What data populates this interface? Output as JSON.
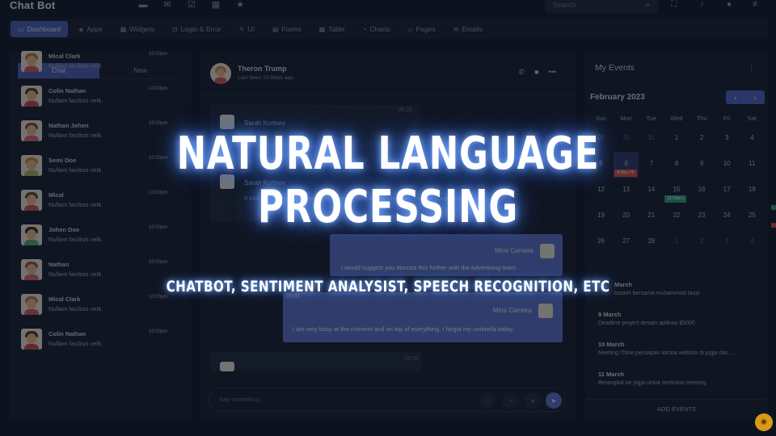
{
  "brand": "Chat Bot",
  "search": {
    "placeholder": "Search"
  },
  "nav": [
    {
      "label": "Dashboard",
      "icon": "monitor-icon",
      "glyph": "▭",
      "active": true
    },
    {
      "label": "Apps",
      "icon": "layers-icon",
      "glyph": "◈"
    },
    {
      "label": "Widgets",
      "icon": "widget-icon",
      "glyph": "▦"
    },
    {
      "label": "Login & Error",
      "icon": "lock-icon",
      "glyph": "⊡"
    },
    {
      "label": "UI",
      "icon": "edit-icon",
      "glyph": "✎"
    },
    {
      "label": "Forms",
      "icon": "file-icon",
      "glyph": "▤"
    },
    {
      "label": "Table",
      "icon": "table-icon",
      "glyph": "▦"
    },
    {
      "label": "Charts",
      "icon": "pie-chart-icon",
      "glyph": "◔"
    },
    {
      "label": "Pages",
      "icon": "folder-icon",
      "glyph": "▱"
    },
    {
      "label": "Emails",
      "icon": "mail-icon",
      "glyph": "✉"
    }
  ],
  "tabs": {
    "chat": "Chat",
    "new": "New"
  },
  "contacts": [
    {
      "name": "Mical Clark",
      "msg": "Nullam facilisis velit.",
      "time": "10:00pm",
      "hair": "#b97a3a",
      "shirt": "#d15b5b"
    },
    {
      "name": "Colin Nathan",
      "msg": "Nullam facilisis velit.",
      "time": "10:00pm",
      "hair": "#5b3a1e",
      "shirt": "#c74c4c"
    },
    {
      "name": "Nathan Johen",
      "msg": "Nullam facilisis velit.",
      "time": "10:00pm",
      "hair": "#8a4e2a",
      "shirt": "#d46a6a"
    },
    {
      "name": "Semi Doe",
      "msg": "Nullam facilisis velit.",
      "time": "10:00pm",
      "hair": "#c7913f",
      "shirt": "#a4b95f"
    },
    {
      "name": "Mical",
      "msg": "Nullam facilisis velit.",
      "time": "10:00pm",
      "hair": "#6e4124",
      "shirt": "#c95656"
    },
    {
      "name": "Johen Doe",
      "msg": "Nullam facilisis velit.",
      "time": "10:00pm",
      "hair": "#3b2818",
      "shirt": "#5da37a"
    },
    {
      "name": "Nathan",
      "msg": "Nullam facilisis velit.",
      "time": "10:00pm",
      "hair": "#9c5a34",
      "shirt": "#d46a6a"
    },
    {
      "name": "Mical Clark",
      "msg": "Nullam facilisis velit.",
      "time": "10:00pm",
      "hair": "#b97a3a",
      "shirt": "#d15b5b"
    },
    {
      "name": "Colin Nathan",
      "msg": "Nullam facilisis velit.",
      "time": "10:00pm",
      "hair": "#5b3a1e",
      "shirt": "#c74c4c"
    }
  ],
  "chat": {
    "name": "Theron Trump",
    "seen": "Last Seen 10:30pm ago",
    "messages": [
      {
        "who": "Sarah Kortney",
        "text": "It looks to me like you have a lot planned before your deadline, I would suggest you p",
        "time": "09:25",
        "side": "in"
      },
      {
        "who": "Sarah Kortney",
        "text": "It looks to me like you have a lot planned before your deadline. I would suggest you p",
        "time": "",
        "side": "in"
      },
      {
        "who": "Mimi Carreira",
        "text": "I would suggest you discuss this further with the advertising team.",
        "time": "",
        "side": "out"
      },
      {
        "who": "Mimi Carreira",
        "text": "I am very busy at the moment and on top of everything, I forgot my umbrella today.",
        "time": "09:41",
        "side": "out"
      },
      {
        "who": "",
        "text": "",
        "time": "09:25",
        "side": "in"
      }
    ],
    "placeholder": "Say something..."
  },
  "events": {
    "title": "My Events",
    "month": "February 2023",
    "weekdays": [
      "Sun",
      "Mon",
      "Tue",
      "Wed",
      "Thu",
      "Fri",
      "Sat"
    ],
    "weeks": [
      [
        "29",
        "30",
        "31",
        "1",
        "2",
        "3",
        "4"
      ],
      [
        "5",
        "6",
        "7",
        "8",
        "9",
        "10",
        "11"
      ],
      [
        "12",
        "13",
        "14",
        "15",
        "16",
        "17",
        "18"
      ],
      [
        "19",
        "20",
        "21",
        "22",
        "23",
        "24",
        "25"
      ],
      [
        "26",
        "27",
        "28",
        "1",
        "2",
        "3",
        "4"
      ]
    ],
    "chips": [
      {
        "text": "9:59a Th",
        "color": "#d9534f"
      },
      {
        "text": "11:59a L",
        "color": "#2aa37a"
      }
    ],
    "list": [
      {
        "date": "March",
        "desc": "basket bersama muhammad fauzi"
      },
      {
        "date": "9 March",
        "desc": "Deadline project desain aplikasi $5000"
      },
      {
        "date": "10 March",
        "desc": "Meeting ITone persiapan lomba website di jogja dan ..."
      },
      {
        "date": "11 March",
        "desc": "Berangkat ke jogja untuk technical meeting"
      }
    ],
    "add": "ADD EVENTS"
  },
  "overlay": {
    "line1": "NATURAL LANGUAGE",
    "line2": "PROCESSING",
    "sub": "CHATBOT, SENTIMENT ANALYSIST, SPEECH RECOGNITION, ETC"
  },
  "colors": {
    "accent": "#4b61b8",
    "bubble_out": "#5c73cc",
    "glow": "#4f86ff"
  }
}
